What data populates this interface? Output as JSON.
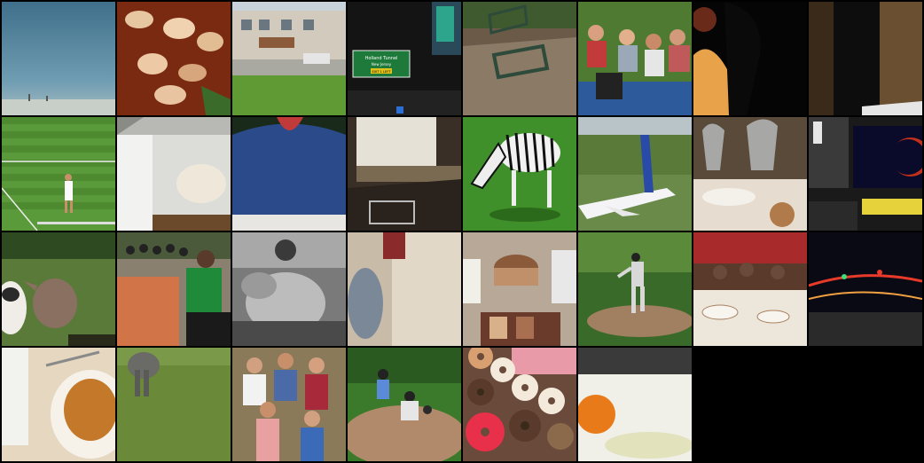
{
  "tiles": [
    {
      "icon": "sky-sea-photo"
    },
    {
      "icon": "food-photo"
    },
    {
      "icon": "street-building-photo"
    },
    {
      "icon": "highway-sign-photo",
      "sign_title": "Holland Tunnel",
      "sign_sub": "New Jersey",
      "sign_exit": "EXIT 1 LEFT"
    },
    {
      "icon": "park-bench-photo"
    },
    {
      "icon": "picnic-people-photo"
    },
    {
      "icon": "silhouette-photo"
    },
    {
      "icon": "dark-room-photo"
    },
    {
      "icon": "tennis-player-photo"
    },
    {
      "icon": "cabinet-cat-photo"
    },
    {
      "icon": "person-sweater-photo"
    },
    {
      "icon": "stove-kitchen-photo"
    },
    {
      "icon": "zebra-photo"
    },
    {
      "icon": "airplane-photo"
    },
    {
      "icon": "glasses-table-photo"
    },
    {
      "icon": "computer-desk-photo"
    },
    {
      "icon": "cows-photo"
    },
    {
      "icon": "crowd-fence-photo"
    },
    {
      "icon": "bw-sheep-photo"
    },
    {
      "icon": "blurry-bottle-photo"
    },
    {
      "icon": "bakery-display-photo"
    },
    {
      "icon": "baseball-pitcher-photo"
    },
    {
      "icon": "restaurant-table-photo"
    },
    {
      "icon": "night-traffic-photo"
    },
    {
      "icon": "pastry-plate-photo"
    },
    {
      "icon": "elephant-field-photo"
    },
    {
      "icon": "group-people-photo"
    },
    {
      "icon": "baseball-catcher-photo"
    },
    {
      "icon": "donuts-photo"
    },
    {
      "icon": "orange-fruit-photo"
    }
  ]
}
